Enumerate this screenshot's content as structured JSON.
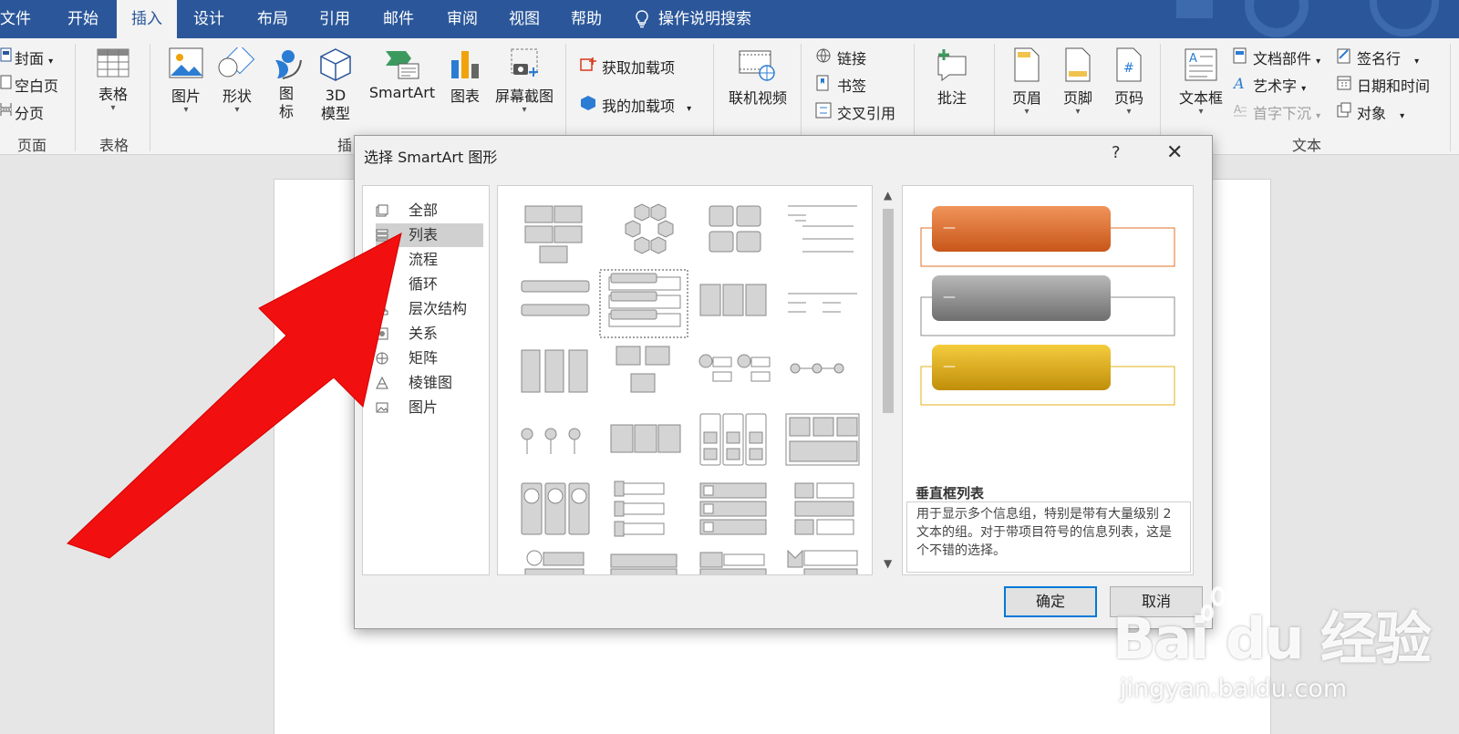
{
  "tabs": [
    "文件",
    "开始",
    "插入",
    "设计",
    "布局",
    "引用",
    "邮件",
    "审阅",
    "视图",
    "帮助"
  ],
  "active_tab": "插入",
  "tell_me": "操作说明搜索",
  "ribbon": {
    "pages": {
      "cover": "封面",
      "blank": "空白页",
      "break": "分页",
      "group": "页面"
    },
    "tables": {
      "table": "表格",
      "group": "表格"
    },
    "illustrations": {
      "picture": "图片",
      "shapes": "形状",
      "icons_1": "图",
      "icons_2": "标",
      "model_1": "3D",
      "model_2": "模型",
      "smartart": "SmartArt",
      "chart": "图表",
      "screenshot": "屏幕截图",
      "group_partial": "插"
    },
    "addins": {
      "get": "获取加载项",
      "my": "我的加载项"
    },
    "media": {
      "video": "联机视频"
    },
    "links": {
      "link": "链接",
      "bookmark": "书签",
      "crossref": "交叉引用"
    },
    "comments": {
      "comment": "批注"
    },
    "headerfooter": {
      "header": "页眉",
      "footer": "页脚",
      "pagenum": "页码"
    },
    "text": {
      "textbox": "文本框",
      "parts": "文档部件",
      "wordart": "艺术字",
      "dropcap": "首字下沉",
      "sigline": "签名行",
      "datetime": "日期和时间",
      "object": "对象",
      "group": "文本"
    }
  },
  "dialog": {
    "title": "选择 SmartArt 图形",
    "help": "?",
    "close": "✕",
    "categories": [
      "全部",
      "列表",
      "流程",
      "循环",
      "层次结构",
      "关系",
      "矩阵",
      "棱锥图",
      "图片"
    ],
    "selected_category": "列表",
    "preview_name": "垂直框列表",
    "preview_desc": "用于显示多个信息组，特别是带有大量级别 2 文本的组。对于带项目符号的信息列表，这是个不错的选择。",
    "preview_bullet": "—",
    "ok": "确定",
    "cancel": "取消",
    "colors": {
      "orange": "#e0712a",
      "gray": "#8c8c8c",
      "gold": "#e3b21a"
    }
  },
  "watermark": {
    "logo": "Bai du 经验",
    "url": "jingyan.baidu.com"
  },
  "annotation_color": "#f20f0f"
}
